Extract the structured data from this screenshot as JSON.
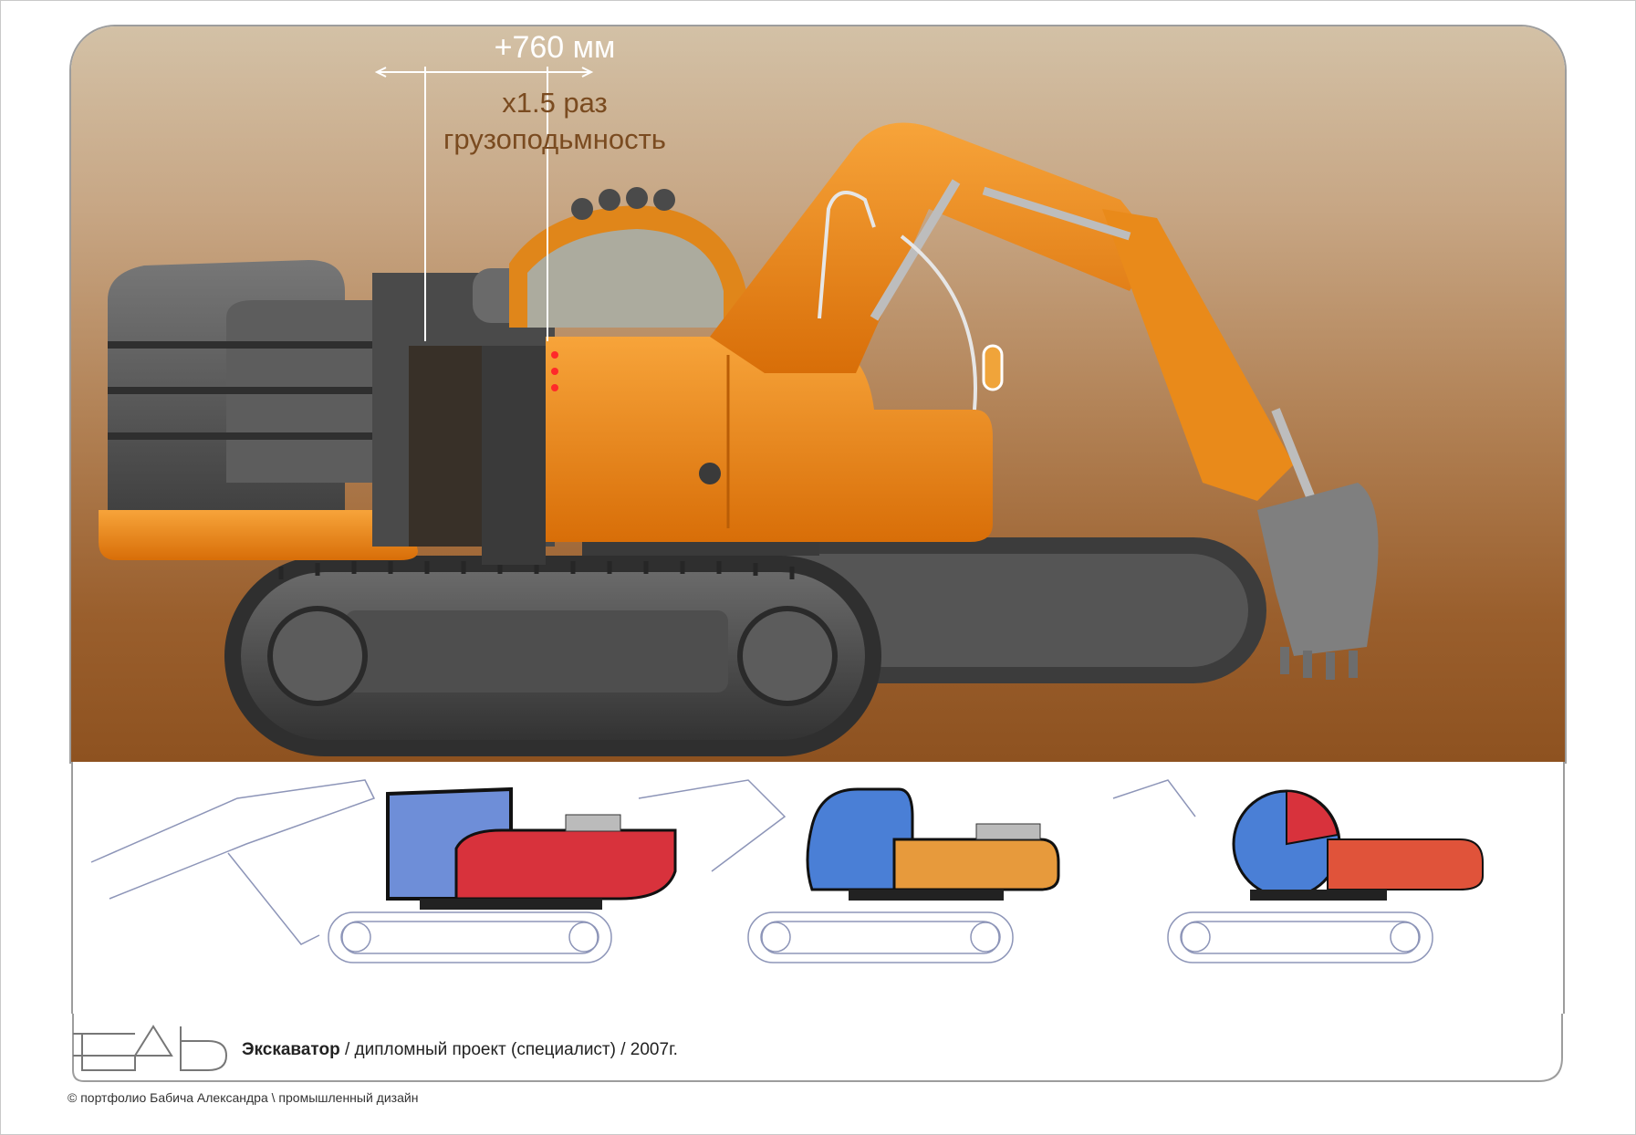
{
  "dimension": {
    "value": "+760 мм",
    "factor": "х1.5 раз",
    "property": "грузоподьмность"
  },
  "caption": {
    "title": "Экскаватор",
    "separator": " / ",
    "description": "дипломный проект (специалист) / 2007г."
  },
  "logo": {
    "letters": "БАБ"
  },
  "copyright": "© портфолио Бабича Александра \\ промышленный дизайн",
  "colors": {
    "body_orange": "#f08a14",
    "counterweight_grey": "#5a5a5a",
    "background_brown": "#9a5f2d",
    "sketch_red": "#d8323c",
    "sketch_blue": "#4a7fd6",
    "sketch_orange": "#e79a3c"
  },
  "sketches": [
    {
      "name": "variant-1",
      "cab_color": "blue",
      "body_color": "red"
    },
    {
      "name": "variant-2",
      "cab_color": "blue",
      "body_color": "orange"
    },
    {
      "name": "variant-3",
      "cab_color": "blue",
      "body_color": "red"
    }
  ]
}
